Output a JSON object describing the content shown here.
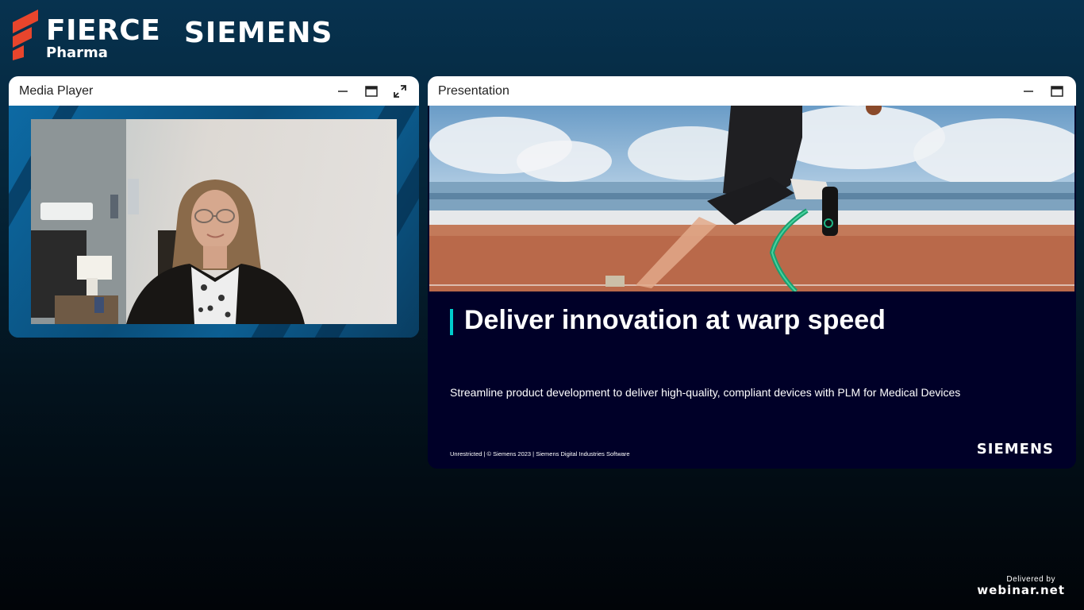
{
  "header": {
    "brand_primary": "FIERCE",
    "brand_primary_sub": "Pharma",
    "brand_sponsor": "SIEMENS"
  },
  "media_player": {
    "title": "Media Player",
    "buttons": {
      "minimize": "minimize-icon",
      "maximize": "window-icon",
      "fullscreen": "expand-icon"
    }
  },
  "presentation": {
    "title": "Presentation",
    "buttons": {
      "minimize": "minimize-icon",
      "maximize": "window-icon"
    },
    "slide": {
      "headline": "Deliver innovation at warp speed",
      "subheadline": "Streamline product development to deliver high-quality, compliant devices with PLM for Medical Devices",
      "footer": "Unrestricted | © Siemens 2023 | Siemens Digital Industries Software",
      "logo": "SIEMENS"
    }
  },
  "footer": {
    "delivered_by": "Delivered by",
    "platform": "webinar.net"
  },
  "colors": {
    "fierce_red": "#e8452c",
    "slide_bg": "#000028",
    "accent_teal": "#00cccc"
  }
}
